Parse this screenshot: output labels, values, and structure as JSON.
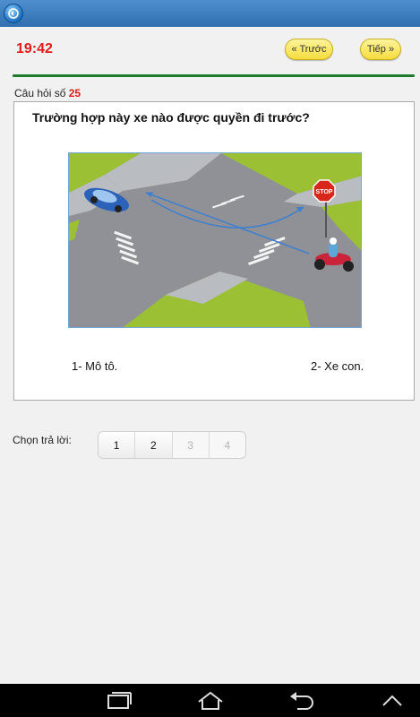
{
  "header": {
    "timer": "19:42",
    "prev_label": "« Trước",
    "next_label": "Tiếp »"
  },
  "question": {
    "label": "Câu hỏi số",
    "number": "25",
    "text": "Trường hợp này xe nào được quyền đi trước?",
    "options": [
      "1- Mô tô.",
      "2- Xe con."
    ],
    "figure_sign_text": "STOP"
  },
  "answer": {
    "label": "Chọn trả lời:",
    "choices": [
      {
        "label": "1",
        "enabled": true
      },
      {
        "label": "2",
        "enabled": true
      },
      {
        "label": "3",
        "enabled": false
      },
      {
        "label": "4",
        "enabled": false
      }
    ]
  },
  "icons": {
    "app": "app-logo-icon",
    "recent": "recent-apps-icon",
    "home": "home-icon",
    "back": "back-icon",
    "up": "chevron-up-icon"
  },
  "colors": {
    "accent_red": "#e01b1b",
    "button_yellow": "#f5dc3e",
    "rule_green": "#1c7a2c",
    "titlebar_blue": "#2f6fb0"
  }
}
